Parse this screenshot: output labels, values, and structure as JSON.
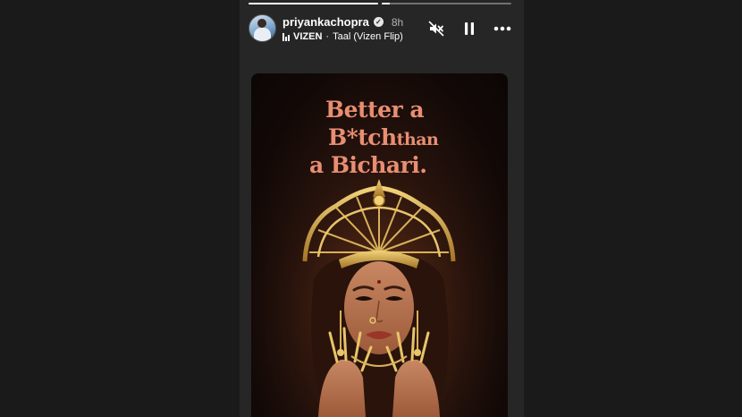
{
  "story": {
    "progress": [
      1.0,
      0.06
    ],
    "user": {
      "username": "priyankachopra",
      "verified_icon": "verified-badge-icon",
      "time_ago": "8h"
    },
    "music": {
      "icon": "music-equalizer-icon",
      "artist": "VIZEN",
      "separator": "·",
      "track": "Taal (Vizen Flip)"
    },
    "controls": {
      "mute_icon": "mute-icon",
      "pause_icon": "pause-icon",
      "more_icon": "more-options-icon"
    },
    "poster": {
      "line1": "Better a",
      "line2_a": "B*tch",
      "line2_b": "than",
      "line3": "a Bichari.",
      "text_color": "#e88e72"
    }
  }
}
